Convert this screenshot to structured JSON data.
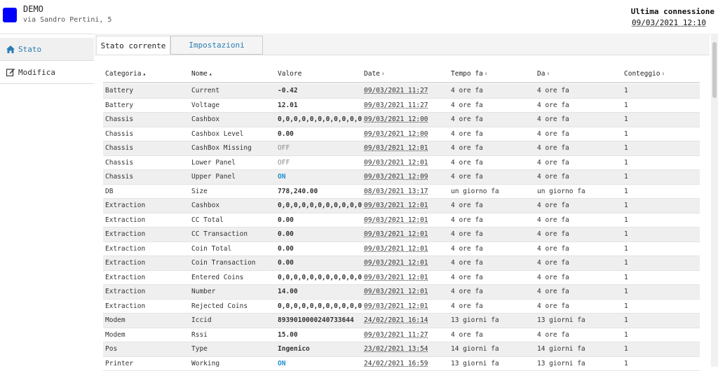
{
  "header": {
    "site_name": "DEMO",
    "site_address": "via Sandro Pertini, 5",
    "last_connection_label": "Ultima connessione",
    "last_connection_value": "09/03/2021 12:10",
    "logo_color": "#0000ff"
  },
  "sidebar": {
    "items": [
      {
        "label": "Stato",
        "icon": "home-icon",
        "active": true
      },
      {
        "label": "Modifica",
        "icon": "edit-icon",
        "active": false
      }
    ]
  },
  "tabs": [
    {
      "label": "Stato corrente",
      "active": true
    },
    {
      "label": "Impostazioni",
      "active": false
    }
  ],
  "table": {
    "columns": [
      {
        "label": "Categoria",
        "sort": "asc"
      },
      {
        "label": "Nome",
        "sort": "asc"
      },
      {
        "label": "Valore",
        "sort": ""
      },
      {
        "label": "Date",
        "sort": "both"
      },
      {
        "label": "Tempo fa",
        "sort": "both"
      },
      {
        "label": "Da",
        "sort": "both"
      },
      {
        "label": "Conteggio",
        "sort": "both"
      }
    ],
    "rows": [
      [
        "Battery",
        "Current",
        "-0.42",
        "09/03/2021 11:27",
        "4 ore fa",
        "4 ore fa",
        "1"
      ],
      [
        "Battery",
        "Voltage",
        "12.01",
        "09/03/2021 11:27",
        "4 ore fa",
        "4 ore fa",
        "1"
      ],
      [
        "Chassis",
        "Cashbox",
        "0,0,0,0,0,0,0,0,0,0,0,0,0,0",
        "09/03/2021 12:00",
        "4 ore fa",
        "4 ore fa",
        "1"
      ],
      [
        "Chassis",
        "Cashbox Level",
        "0.00",
        "09/03/2021 12:00",
        "4 ore fa",
        "4 ore fa",
        "1"
      ],
      [
        "Chassis",
        "CashBox Missing",
        "OFF",
        "09/03/2021 12:01",
        "4 ore fa",
        "4 ore fa",
        "1"
      ],
      [
        "Chassis",
        "Lower Panel",
        "OFF",
        "09/03/2021 12:01",
        "4 ore fa",
        "4 ore fa",
        "1"
      ],
      [
        "Chassis",
        "Upper Panel",
        "ON",
        "09/03/2021 12:09",
        "4 ore fa",
        "4 ore fa",
        "1"
      ],
      [
        "DB",
        "Size",
        "778,240.00",
        "08/03/2021 13:17",
        "un giorno fa",
        "un giorno fa",
        "1"
      ],
      [
        "Extraction",
        "Cashbox",
        "0,0,0,0,0,0,0,0,0,0,0,0,0,0",
        "09/03/2021 12:01",
        "4 ore fa",
        "4 ore fa",
        "1"
      ],
      [
        "Extraction",
        "CC Total",
        "0.00",
        "09/03/2021 12:01",
        "4 ore fa",
        "4 ore fa",
        "1"
      ],
      [
        "Extraction",
        "CC Transaction",
        "0.00",
        "09/03/2021 12:01",
        "4 ore fa",
        "4 ore fa",
        "1"
      ],
      [
        "Extraction",
        "Coin Total",
        "0.00",
        "09/03/2021 12:01",
        "4 ore fa",
        "4 ore fa",
        "1"
      ],
      [
        "Extraction",
        "Coin Transaction",
        "0.00",
        "09/03/2021 12:01",
        "4 ore fa",
        "4 ore fa",
        "1"
      ],
      [
        "Extraction",
        "Entered Coins",
        "0,0,0,0,0,0,0,0,0,0,0,0,0,0",
        "09/03/2021 12:01",
        "4 ore fa",
        "4 ore fa",
        "1"
      ],
      [
        "Extraction",
        "Number",
        "14.00",
        "09/03/2021 12:01",
        "4 ore fa",
        "4 ore fa",
        "1"
      ],
      [
        "Extraction",
        "Rejected Coins",
        "0,0,0,0,0,0,0,0,0,0,0,0,0,0",
        "09/03/2021 12:01",
        "4 ore fa",
        "4 ore fa",
        "1"
      ],
      [
        "Modem",
        "Iccid",
        "8939010000240733644",
        "24/02/2021 16:14",
        "13 giorni fa",
        "13 giorni fa",
        "1"
      ],
      [
        "Modem",
        "Rssi",
        "15.00",
        "09/03/2021 11:27",
        "4 ore fa",
        "4 ore fa",
        "1"
      ],
      [
        "Pos",
        "Type",
        "Ingenico",
        "23/02/2021 13:54",
        "14 giorni fa",
        "14 giorni fa",
        "1"
      ],
      [
        "Printer",
        "Working",
        "ON",
        "24/02/2021 16:59",
        "13 giorni fa",
        "13 giorni fa",
        "1"
      ]
    ]
  },
  "colors": {
    "accent": "#2a7db3",
    "on_value": "#1f8fd0",
    "stripe": "#efefef"
  }
}
